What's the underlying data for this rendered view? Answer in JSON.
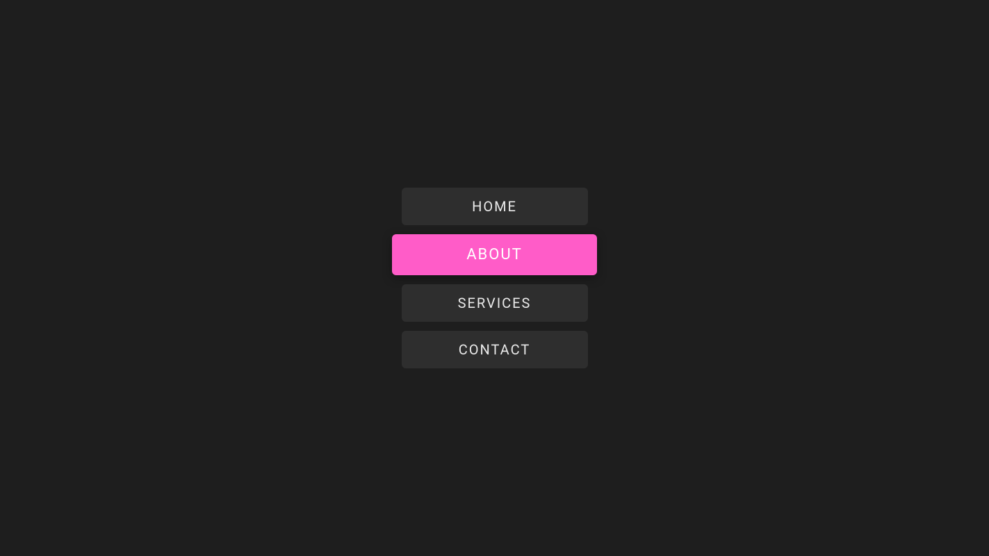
{
  "nav": {
    "items": [
      {
        "label": "Home",
        "active": false
      },
      {
        "label": "About",
        "active": true
      },
      {
        "label": "Services",
        "active": false
      },
      {
        "label": "Contact",
        "active": false
      }
    ]
  },
  "colors": {
    "background": "#1e1e1e",
    "item_bg": "#2e2e2e",
    "accent": "#ff5cc8",
    "text": "rgba(255,255,255,0.9)"
  }
}
